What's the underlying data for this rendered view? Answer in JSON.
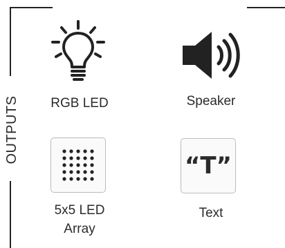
{
  "section": {
    "label": "OUTPUTS"
  },
  "items": [
    {
      "label": "RGB LED",
      "icon": "lightbulb-icon"
    },
    {
      "label": "Speaker",
      "icon": "speaker-icon"
    },
    {
      "label_line1": "5x5 LED",
      "label_line2": "Array",
      "icon": "led-grid-icon"
    },
    {
      "label": "Text",
      "icon_text": "“T”",
      "icon": "text-icon"
    }
  ],
  "colors": {
    "icon": "#222222",
    "text": "#2b2b2b",
    "card_border": "#bbbbbb"
  }
}
